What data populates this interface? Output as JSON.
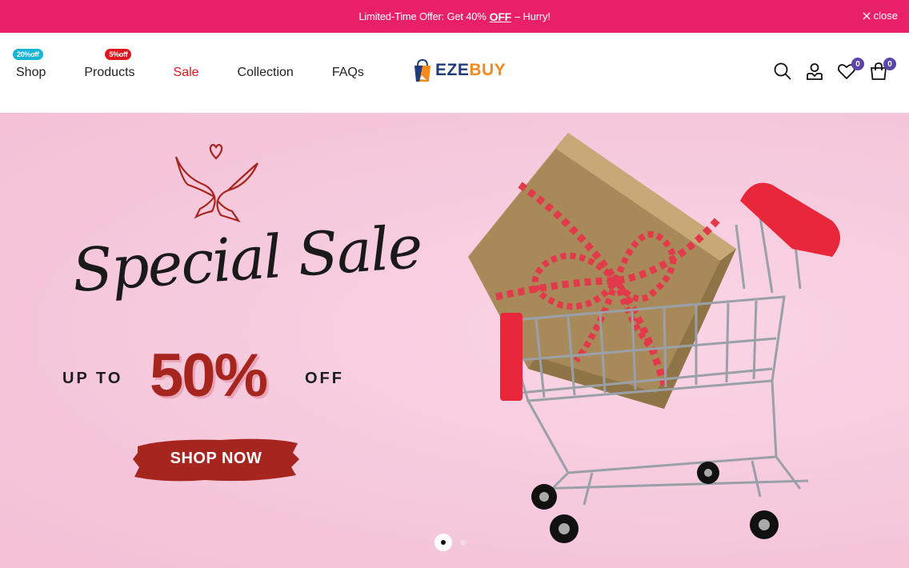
{
  "announcement": {
    "prefix": "Limited-Time Offer: Get 40%",
    "highlight": "OFF",
    "suffix": "– Hurry!",
    "close_label": "close"
  },
  "nav": {
    "items": [
      {
        "label": "Shop",
        "badge": "20%off",
        "badge_color": "#18b4d6"
      },
      {
        "label": "Products",
        "badge": "5%off",
        "badge_color": "#e0161e"
      },
      {
        "label": "Sale",
        "color": "#e0161e"
      },
      {
        "label": "Collection"
      },
      {
        "label": "FAQs"
      }
    ]
  },
  "logo": {
    "part1": "EZE",
    "part2": "BUY"
  },
  "header_icons": {
    "search": "search-icon",
    "account": "user-icon",
    "wishlist": "heart-icon",
    "wishlist_count": "0",
    "cart": "cart-icon",
    "cart_count": "0"
  },
  "hero": {
    "script_title": "Special Sale",
    "up_to": "UP TO",
    "percent": "50%",
    "off": "OFF",
    "cta": "SHOP NOW",
    "slides_total": 2,
    "active_slide": 1
  },
  "colors": {
    "announcement_bg": "#e8206a",
    "hero_bg": "#f5c6dc",
    "accent_red": "#a6261f",
    "badge_purple": "#5b46a8"
  }
}
